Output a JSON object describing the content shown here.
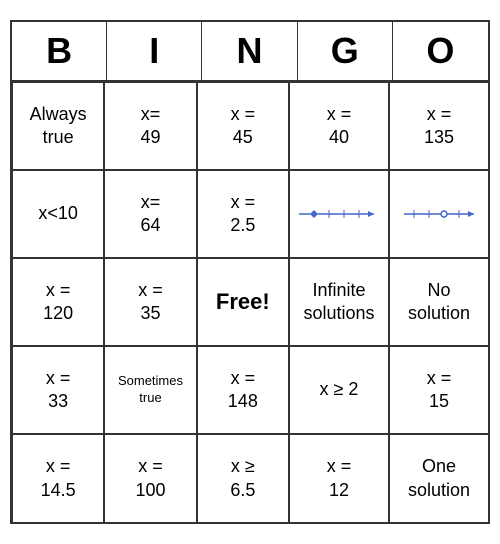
{
  "header": {
    "letters": [
      "B",
      "I",
      "N",
      "G",
      "O"
    ]
  },
  "cells": [
    {
      "id": "r1c1",
      "text": "Always\ntrue",
      "type": "text"
    },
    {
      "id": "r1c2",
      "text": "x=\n49",
      "type": "text"
    },
    {
      "id": "r1c3",
      "text": "x =\n45",
      "type": "text"
    },
    {
      "id": "r1c4",
      "text": "x =\n40",
      "type": "text"
    },
    {
      "id": "r1c5",
      "text": "x =\n135",
      "type": "text"
    },
    {
      "id": "r2c1",
      "text": "x<10",
      "type": "text"
    },
    {
      "id": "r2c2",
      "text": "x=\n64",
      "type": "text"
    },
    {
      "id": "r2c3",
      "text": "x =\n2.5",
      "type": "text"
    },
    {
      "id": "r2c4",
      "text": "",
      "type": "numberline1"
    },
    {
      "id": "r2c5",
      "text": "",
      "type": "numberline2"
    },
    {
      "id": "r3c1",
      "text": "x =\n120",
      "type": "text"
    },
    {
      "id": "r3c2",
      "text": "x =\n35",
      "type": "text"
    },
    {
      "id": "r3c3",
      "text": "Free!",
      "type": "free"
    },
    {
      "id": "r3c4",
      "text": "Infinite\nsolutions",
      "type": "text"
    },
    {
      "id": "r3c5",
      "text": "No\nsolution",
      "type": "text"
    },
    {
      "id": "r4c1",
      "text": "x =\n33",
      "type": "text"
    },
    {
      "id": "r4c2",
      "text": "Sometimes\ntrue",
      "type": "small"
    },
    {
      "id": "r4c3",
      "text": "x =\n148",
      "type": "text"
    },
    {
      "id": "r4c4",
      "text": "x ≥ 2",
      "type": "text"
    },
    {
      "id": "r4c5",
      "text": "x =\n15",
      "type": "text"
    },
    {
      "id": "r5c1",
      "text": "x =\n14.5",
      "type": "text"
    },
    {
      "id": "r5c2",
      "text": "x =\n100",
      "type": "text"
    },
    {
      "id": "r5c3",
      "text": "x ≥\n6.5",
      "type": "text"
    },
    {
      "id": "r5c4",
      "text": "x =\n12",
      "type": "text"
    },
    {
      "id": "r5c5",
      "text": "One\nsolution",
      "type": "text"
    }
  ]
}
